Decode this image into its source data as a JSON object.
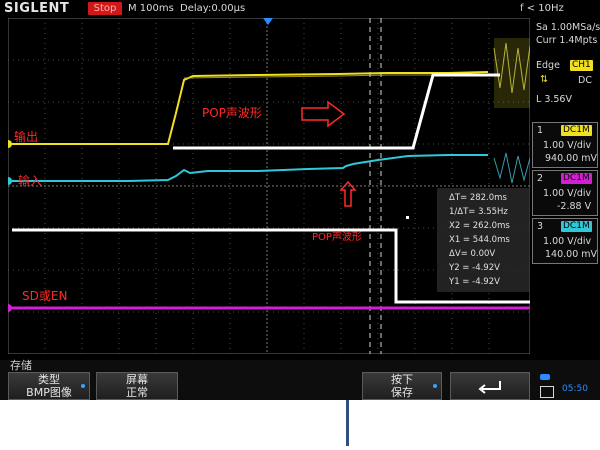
{
  "topbar": {
    "brand": "SIGLENT",
    "run_state": "Stop",
    "timebase": "M 100ms",
    "delay": "Delay:0.00μs",
    "trigger_freq_symbol": "f",
    "trigger_freq": "< 10Hz"
  },
  "acquisition": {
    "sample_rate": "Sa 1.00MSa/s",
    "memory": "Curr 1.4Mpts"
  },
  "trigger": {
    "type": "Edge",
    "source": "CH1",
    "slope_symbol": "⇅",
    "coupling": "DC",
    "level": "L  3.56V"
  },
  "channels": [
    {
      "num": "1",
      "coupling": "DC1M",
      "scale": "1.00 V/div",
      "offset": "940.00 mV",
      "color": "#f0e020"
    },
    {
      "num": "2",
      "coupling": "DC1M",
      "scale": "1.00 V/div",
      "offset": "-2.88 V",
      "color": "#d020d0"
    },
    {
      "num": "3",
      "coupling": "DC1M",
      "scale": "1.00 V/div",
      "offset": "140.00 mV",
      "color": "#30c8d8"
    }
  ],
  "measurements": [
    "ΔT= 282.0ms",
    "1/ΔT= 3.55Hz",
    "X2 = 262.0ms",
    "X1 = 544.0ms",
    "ΔV= 0.00V",
    "Y2 = -4.92V",
    "Y1 = -4.92V"
  ],
  "annotations": {
    "pop_label_top": "POP声波形",
    "pop_label_mid": "POP声波形",
    "output_label": "输出",
    "input_label": "输入",
    "sd_label": "SD或EN"
  },
  "softkeys": {
    "menu_title": "存储",
    "type_line1": "类型",
    "type_line2": "BMP图像",
    "screen_line1": "屏幕",
    "screen_line2": "正常",
    "press_line1": "按下",
    "press_line2": "保存",
    "back_icon": "return-arrow-icon"
  },
  "status": {
    "time": "05:50"
  },
  "colors": {
    "ch1": "#f0e020",
    "ch2": "#d020d0",
    "ch3": "#30c8d8",
    "annotation_red": "#ff2a2a",
    "stop_red": "#d01818"
  }
}
